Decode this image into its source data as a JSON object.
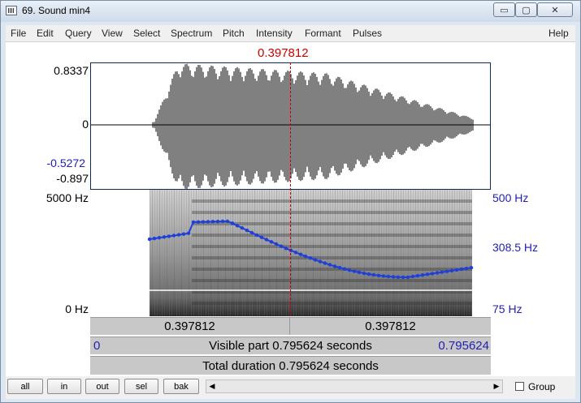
{
  "window": {
    "title": "69. Sound min4",
    "controls": {
      "minimize": "▭",
      "maximize": "▢",
      "close": "✕"
    }
  },
  "menu": [
    "File",
    "Edit",
    "Query",
    "View",
    "Select",
    "Spectrum",
    "Pitch",
    "Intensity",
    "Formant",
    "Pulses",
    "Help"
  ],
  "cursor_time": "0.397812",
  "waveform": {
    "ymax_label": "0.8337",
    "zero_label": "0",
    "ymin_blue_label": "-0.5272",
    "ymin_label": "-0.897"
  },
  "spectrogram": {
    "fmax_label": "5000 Hz",
    "fmin_label": "0 Hz",
    "pitch_max_label": "500 Hz",
    "pitch_mid_label": "308.5 Hz",
    "pitch_min_label": "75 Hz"
  },
  "bars": {
    "left_time": "0.397812",
    "right_time": "0.397812",
    "visible_start": "0",
    "visible_text": "Visible part 0.795624 seconds",
    "visible_end": "0.795624",
    "total_text": "Total duration 0.795624 seconds"
  },
  "buttons": [
    "all",
    "in",
    "out",
    "sel",
    "bak"
  ],
  "scroll": {
    "left_arrow": "◀",
    "right_arrow": "▶"
  },
  "group_label": "Group",
  "colors": {
    "cursor": "#cc0000",
    "pitch_curve": "#1f3fd8",
    "axis_label_blue": "#1f1fb0"
  },
  "icons": {
    "app": "sound-window-icon"
  }
}
